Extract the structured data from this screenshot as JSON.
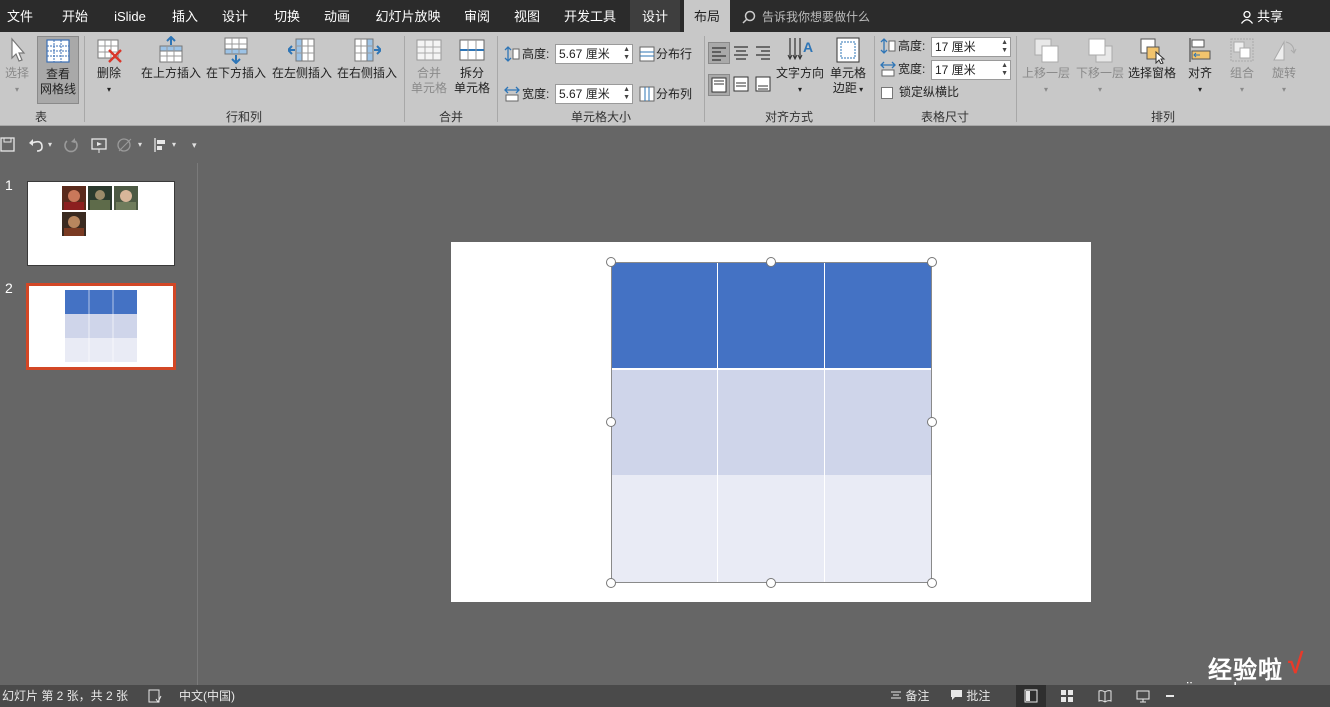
{
  "tabs": [
    {
      "label": "文件",
      "active": false
    },
    {
      "label": "开始",
      "active": false
    },
    {
      "label": "iSlide",
      "active": false
    },
    {
      "label": "插入",
      "active": false
    },
    {
      "label": "设计",
      "active": false
    },
    {
      "label": "切换",
      "active": false
    },
    {
      "label": "动画",
      "active": false
    },
    {
      "label": "幻灯片放映",
      "active": false
    },
    {
      "label": "审阅",
      "active": false
    },
    {
      "label": "视图",
      "active": false
    },
    {
      "label": "开发工具",
      "active": false
    },
    {
      "label": "设计",
      "context": true
    },
    {
      "label": "布局",
      "active": true
    }
  ],
  "tell_me": {
    "placeholder": "告诉我你想要做什么"
  },
  "share": {
    "label": "共享"
  },
  "ribbon": {
    "table_group": {
      "label": "表",
      "select": "选择",
      "gridlines_line1": "查看",
      "gridlines_line2": "网格线"
    },
    "rows_cols_group": {
      "label": "行和列",
      "delete": "删除",
      "insert_above": "在上方插入",
      "insert_below": "在下方插入",
      "insert_left": "在左侧插入",
      "insert_right": "在右侧插入"
    },
    "merge_group": {
      "label": "合并",
      "merge_line1": "合并",
      "merge_line2": "单元格",
      "split_line1": "拆分",
      "split_line2": "单元格"
    },
    "cell_size_group": {
      "label": "单元格大小",
      "height_label": "高度:",
      "height_value": "5.67 厘米",
      "width_label": "宽度:",
      "width_value": "5.67 厘米",
      "distribute_rows": "分布行",
      "distribute_cols": "分布列"
    },
    "alignment_group": {
      "label": "对齐方式",
      "text_direction": "文字方向",
      "cell_margins_line1": "单元格",
      "cell_margins_line2": "边距"
    },
    "table_size_group": {
      "label": "表格尺寸",
      "height_label": "高度:",
      "height_value": "17 厘米",
      "width_label": "宽度:",
      "width_value": "17 厘米",
      "lock_aspect": "锁定纵横比"
    },
    "arrange_group": {
      "label": "排列",
      "bring_forward": "上移一层",
      "send_backward": "下移一层",
      "selection_pane": "选择窗格",
      "align": "对齐",
      "group": "组合",
      "rotate": "旋转"
    }
  },
  "slides": [
    {
      "number": "1"
    },
    {
      "number": "2"
    }
  ],
  "table": {
    "colors": {
      "header": "#4472c4",
      "row_odd": "#cfd5ea",
      "row_even": "#e9ebf5",
      "selection": "#d24726"
    },
    "rows": 3,
    "cols": 3
  },
  "status": {
    "slide_info": "幻灯片 第 2 张，共 2 张",
    "language": "中文(中国)",
    "notes": "备注",
    "comments": "批注"
  },
  "watermark": {
    "text": "经验啦",
    "url": "jingyanla.com",
    "mark": "√"
  }
}
